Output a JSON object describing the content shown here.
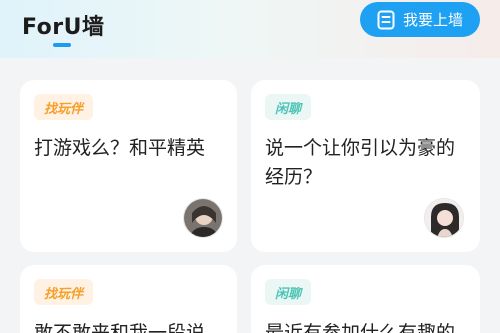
{
  "header": {
    "title": "ForU墙",
    "post_button_label": "我要上墙",
    "accent_color": "#1ea0f3"
  },
  "cards": [
    {
      "tag": "找玩伴",
      "tag_color": "#f5a02a",
      "title": "打游戏么？和平精英"
    },
    {
      "tag": "闲聊",
      "tag_color": "#4fc4b6",
      "title": "说一个让你引以为豪的经历？"
    },
    {
      "tag": "找玩伴",
      "tag_color": "#f5a02a",
      "title": "敢不敢来和我一段说"
    },
    {
      "tag": "闲聊",
      "tag_color": "#4fc4b6",
      "title": "最近有参加什么有趣的"
    }
  ]
}
